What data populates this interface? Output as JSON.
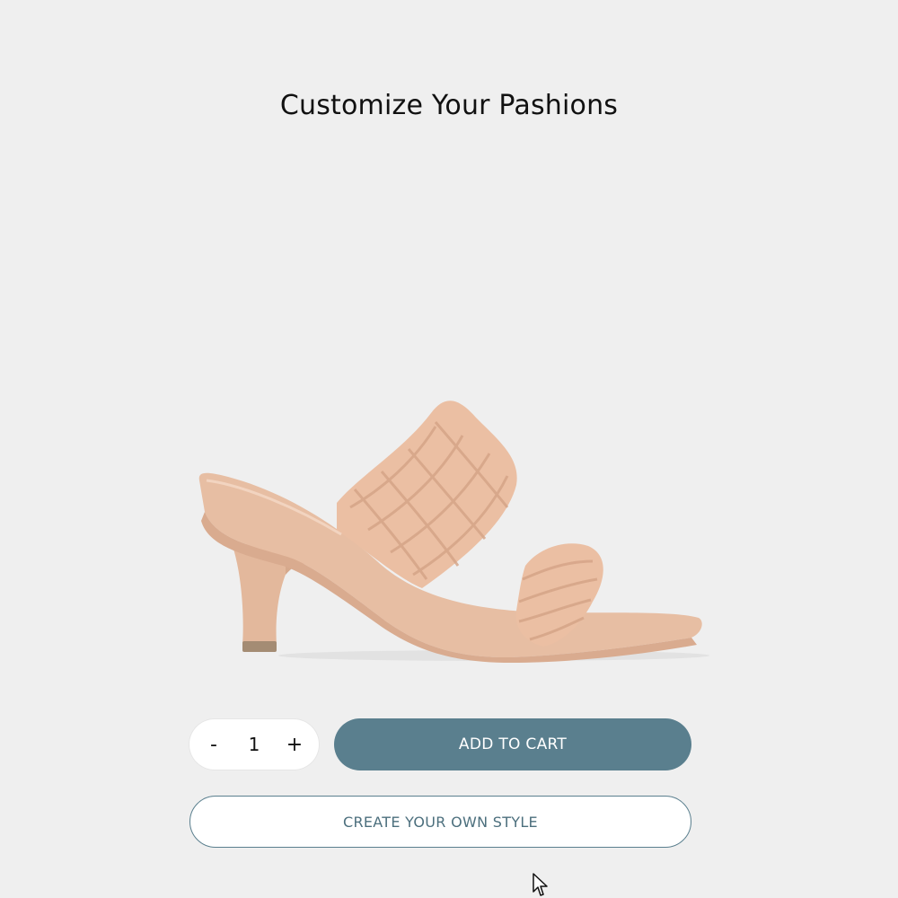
{
  "header": {
    "title": "Customize Your Pashions"
  },
  "product": {
    "image_icon": "braided-heel-sandal-image",
    "color": "#e8c2a6"
  },
  "quantity": {
    "decrement_label": "-",
    "value": "1",
    "increment_label": "+"
  },
  "actions": {
    "add_to_cart_label": "ADD TO CART",
    "create_style_label": "CREATE YOUR OWN STYLE"
  },
  "theme": {
    "background": "#efefef",
    "accent": "#5a7f8e"
  }
}
